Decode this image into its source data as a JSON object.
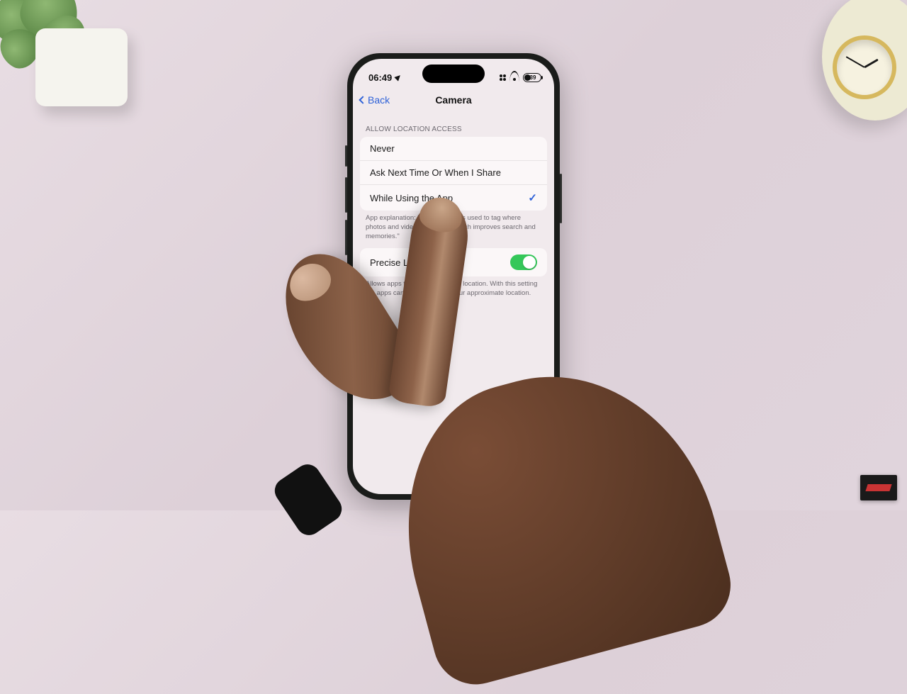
{
  "statusbar": {
    "time": "06:49",
    "battery_pct": "39"
  },
  "nav": {
    "back_label": "Back",
    "title": "Camera"
  },
  "location_section": {
    "header": "ALLOW LOCATION ACCESS",
    "options": [
      {
        "label": "Never",
        "selected": false
      },
      {
        "label": "Ask Next Time Or When I Share",
        "selected": false
      },
      {
        "label": "While Using the App",
        "selected": true
      }
    ],
    "footer": "App explanation: \"Your location is used to tag where photos and videos are taken, which improves search and memories.\""
  },
  "precise_section": {
    "label": "Precise Location",
    "on": true,
    "footer": "Allows apps to use your specific location. With this setting off, apps can only determine your approximate location."
  },
  "colors": {
    "ios_blue": "#2f62d8",
    "ios_green": "#34c759"
  }
}
